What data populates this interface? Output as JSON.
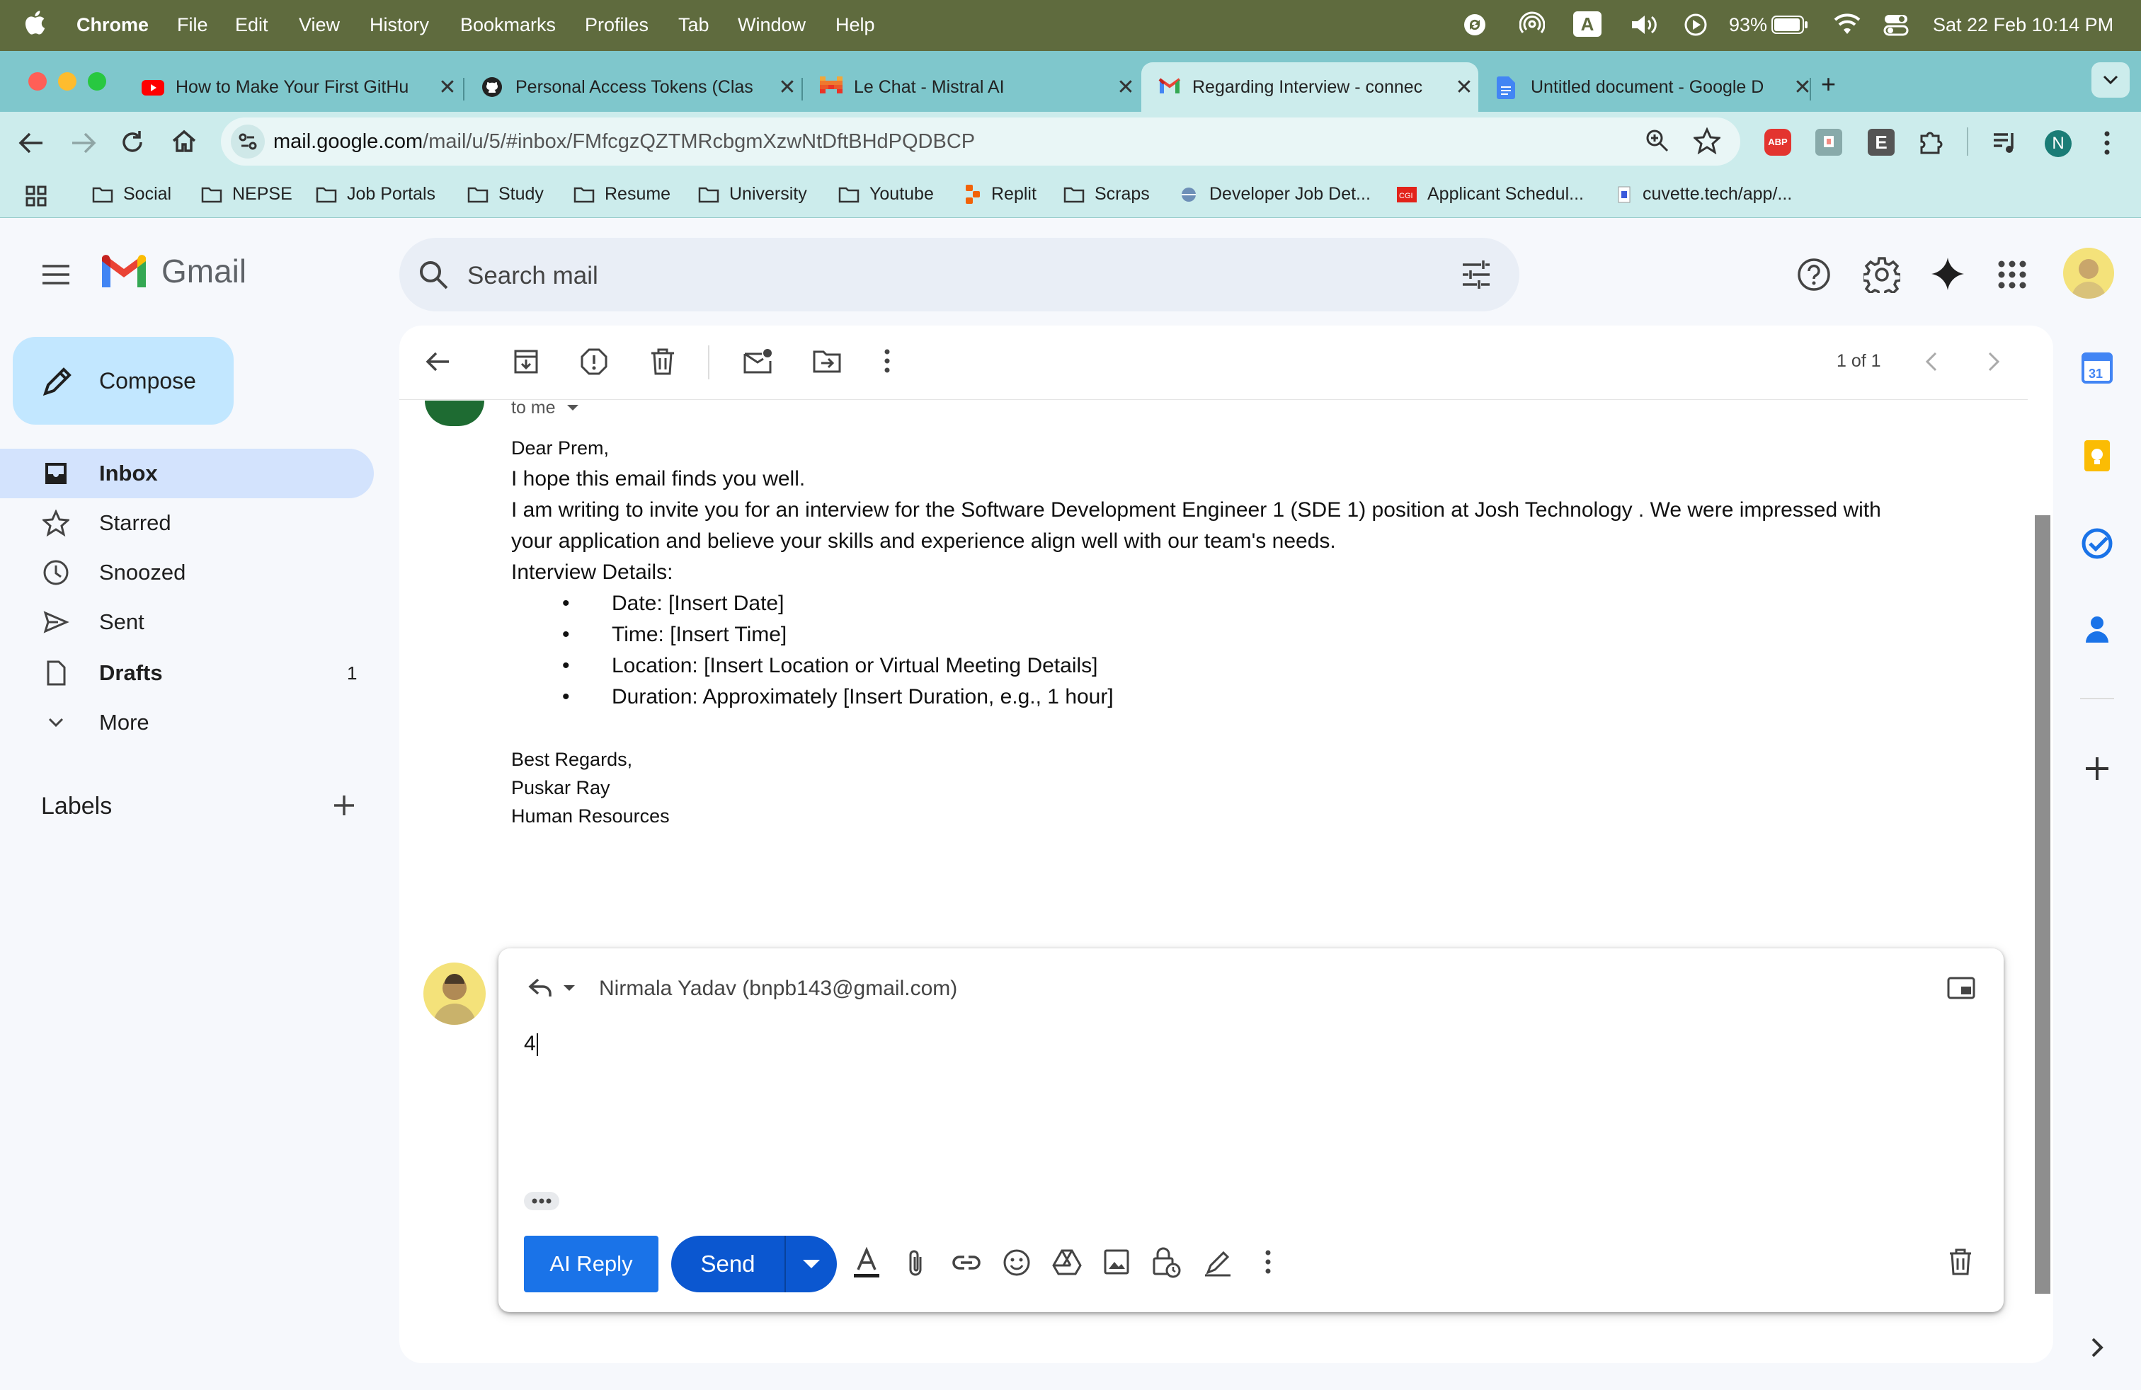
{
  "menubar": {
    "app": "Chrome",
    "menus": [
      "File",
      "Edit",
      "View",
      "History",
      "Bookmarks",
      "Profiles",
      "Tab",
      "Window",
      "Help"
    ],
    "battery": "93%",
    "datetime": "Sat 22 Feb  10:14 PM",
    "keyboard_indicator": "A"
  },
  "tabs": [
    {
      "title": "How to Make Your First GitHu",
      "icon": "youtube-icon"
    },
    {
      "title": "Personal Access Tokens (Clas",
      "icon": "github-icon"
    },
    {
      "title": "Le Chat - Mistral AI",
      "icon": "mistral-icon"
    },
    {
      "title": "Regarding Interview - connec",
      "icon": "gmail-icon",
      "active": true
    },
    {
      "title": "Untitled document - Google D",
      "icon": "docs-icon"
    }
  ],
  "toolbar": {
    "url_host": "mail.google.com",
    "url_path": "/mail/u/5/#inbox/FMfcgzQZTMRcbgmXzwNtDftBHdPQDBCP",
    "profile_initial": "N",
    "ext_e": "E",
    "ext_abp": "ABP"
  },
  "bookmarks": [
    {
      "label": "Social",
      "icon": "folder-icon"
    },
    {
      "label": "NEPSE",
      "icon": "folder-icon"
    },
    {
      "label": "Job Portals",
      "icon": "folder-icon"
    },
    {
      "label": "Study",
      "icon": "folder-icon"
    },
    {
      "label": "Resume",
      "icon": "folder-icon"
    },
    {
      "label": "University",
      "icon": "folder-icon"
    },
    {
      "label": "Youtube",
      "icon": "folder-icon"
    },
    {
      "label": "Replit",
      "icon": "replit-icon"
    },
    {
      "label": "Scraps",
      "icon": "folder-icon"
    },
    {
      "label": "Developer Job Det...",
      "icon": "site-icon"
    },
    {
      "label": "Applicant Schedul...",
      "icon": "site-icon"
    },
    {
      "label": "cuvette.tech/app/...",
      "icon": "site-icon"
    }
  ],
  "gmail": {
    "logo_text": "Gmail",
    "search_placeholder": "Search mail",
    "compose_label": "Compose",
    "nav": [
      {
        "label": "Inbox",
        "icon": "inbox-icon",
        "selected": true,
        "count": ""
      },
      {
        "label": "Starred",
        "icon": "star-icon",
        "count": ""
      },
      {
        "label": "Snoozed",
        "icon": "clock-icon",
        "count": ""
      },
      {
        "label": "Sent",
        "icon": "send-icon",
        "count": ""
      },
      {
        "label": "Drafts",
        "icon": "draft-icon",
        "count": "1"
      },
      {
        "label": "More",
        "icon": "chevron-down-icon",
        "count": ""
      }
    ],
    "labels_heading": "Labels",
    "pager": "1 of 1"
  },
  "email": {
    "to_me": "to me",
    "greeting": "Dear Prem,",
    "line1": "I hope this email finds you well.",
    "line2a": "I am writing to invite you for an interview for the Software Development Engineer 1 (SDE 1) position at Josh Technology . We were impressed with",
    "line2b": "your application and believe your skills and experience align well with our team's needs.",
    "details_heading": "Interview Details:",
    "details": [
      "Date: [Insert Date]",
      "Time: [Insert Time]",
      "Location: [Insert Location or Virtual Meeting Details]",
      "Duration: Approximately [Insert Duration, e.g., 1 hour]"
    ],
    "signoff": "Best Regards,",
    "sender_name": "Puskar Ray",
    "sender_title": "Human Resources"
  },
  "reply": {
    "recipient": "Nirmala Yadav (bnpb143@gmail.com)",
    "body": "4",
    "ai_reply_label": "AI Reply",
    "send_label": "Send"
  },
  "colors": {
    "menubar": "#5f6b3e",
    "tabstrip": "#7fc7cc",
    "toolbar": "#ccecec",
    "compose": "#c2e7ff",
    "nav_selected": "#d3e3fd",
    "send": "#0b57d0",
    "ai_reply": "#1a73e8"
  }
}
